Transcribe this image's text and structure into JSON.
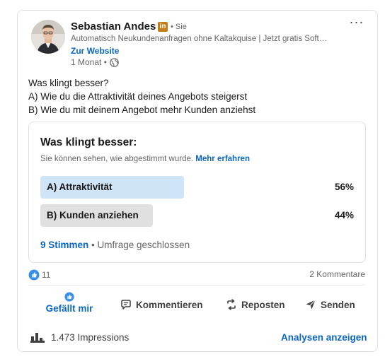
{
  "author": {
    "name": "Sebastian Andes",
    "badge": "in",
    "follow_meta": "• Sie",
    "headline": "Automatisch Neukundenanfragen ohne Kaltakquise | Jetzt gratis Soft…",
    "website_link": "Zur Website",
    "time": "1 Monat •"
  },
  "more_menu": "···",
  "post": {
    "lines": [
      "Was klingt besser?",
      "A) Wie du die Attraktivität deines Angebots steigerst",
      "B) Wie du mit deinem Angebot mehr Kunden anziehst"
    ]
  },
  "poll": {
    "title": "Was klingt besser:",
    "note": "Sie können sehen, wie abgestimmt wurde.",
    "note_link": "Mehr erfahren",
    "options": [
      {
        "label": "A) Attraktivität",
        "percent": "56%",
        "share": 0.56
      },
      {
        "label": "B) Kunden anziehen",
        "percent": "44%",
        "share": 0.44
      }
    ],
    "votes": "9 Stimmen",
    "status": " • Umfrage geschlossen"
  },
  "social": {
    "likes": "11",
    "comments": "2 Kommentare"
  },
  "actions": {
    "like": "Gefällt mir",
    "comment": "Kommentieren",
    "repost": "Reposten",
    "send": "Senden"
  },
  "footer": {
    "impressions": "1.473 Impressions",
    "analytics": "Analysen anzeigen"
  },
  "colors": {
    "accent": "#0a66c2",
    "winning_option": "#d0e4f8",
    "losing_option": "#e0e0e0",
    "badge": "#c37d16"
  },
  "icons": [
    "globe-icon",
    "like-reaction-icon",
    "thumbs-up-icon",
    "comment-icon",
    "repost-icon",
    "send-icon",
    "analytics-bar-icon"
  ]
}
